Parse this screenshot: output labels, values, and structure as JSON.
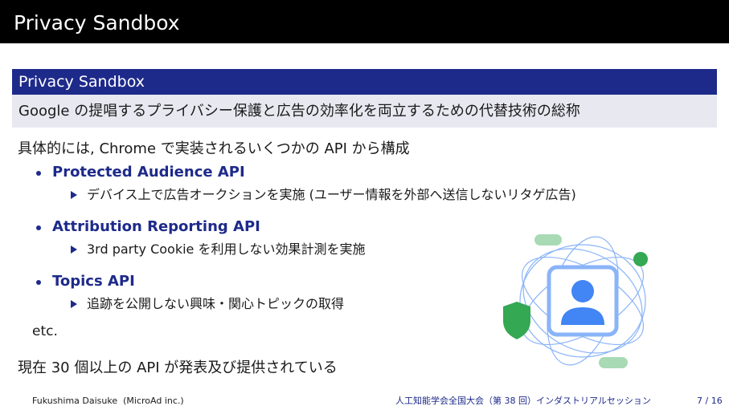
{
  "slide": {
    "title": "Privacy Sandbox",
    "block_title": "Privacy Sandbox",
    "block_body": "Google の提唱するプライバシー保護と広告の効率化を両立するための代替技術の総称",
    "intro": "具体的には, Chrome で実装されるいくつかの API から構成",
    "items": [
      {
        "title": "Protected Audience API",
        "detail": "デバイス上で広告オークションを実施 (ユーザー情報を外部へ送信しないリタゲ広告)"
      },
      {
        "title": "Attribution Reporting API",
        "detail": "3rd party Cookie を利用しない効果計測を実施"
      },
      {
        "title": "Topics API",
        "detail": "追跡を公開しない興味・関心トピックの取得"
      }
    ],
    "etc": "etc.",
    "summary": "現在 30 個以上の API が発表及び提供されている"
  },
  "footer": {
    "author": "Fukushima Daisuke  (MicroAd inc.)",
    "conference": "人工知能学会全国大会（第 38 回）インダストリアルセッション",
    "page": "7 / 16"
  },
  "illustration": {
    "icon": "user-profile-icon",
    "colors": {
      "blue": "#4285f4",
      "green": "#34a853",
      "light_green": "#a8dab5",
      "outline": "#8ab4f8"
    }
  }
}
